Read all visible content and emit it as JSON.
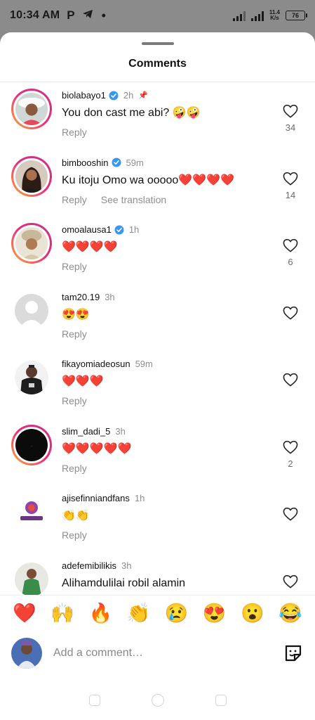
{
  "status_bar": {
    "time": "10:34 AM",
    "app_letter": "P",
    "net_top": "11.4",
    "net_bottom": "K/s",
    "battery": "76"
  },
  "sheet": {
    "title": "Comments"
  },
  "comments": [
    {
      "username": "biolabayo1",
      "verified": true,
      "time": "2h",
      "pinned": true,
      "text": "You don cast me abi? 🤪🤪",
      "reply_label": "Reply",
      "translate_label": "",
      "likes": "34",
      "avatar": "woman-in-white-hat-photo",
      "ring": true
    },
    {
      "username": "bimbooshin",
      "verified": true,
      "time": "59m",
      "pinned": false,
      "text": "Ku itoju Omo wa ooooo❤️❤️❤️❤️",
      "reply_label": "Reply",
      "translate_label": "See translation",
      "likes": "14",
      "avatar": "woman-long-hair-photo",
      "ring": true
    },
    {
      "username": "omoalausa1",
      "verified": true,
      "time": "1h",
      "pinned": false,
      "text": "❤️❤️❤️❤️",
      "reply_label": "Reply",
      "translate_label": "",
      "likes": "6",
      "avatar": "woman-gele-photo",
      "ring": true
    },
    {
      "username": "tam20.19",
      "verified": false,
      "time": "3h",
      "pinned": false,
      "text": "😍😍",
      "reply_label": "Reply",
      "translate_label": "",
      "likes": "",
      "avatar": "default-avatar",
      "ring": false
    },
    {
      "username": "fikayomiadeosun",
      "verified": false,
      "time": "59m",
      "pinned": false,
      "text": "❤️❤️❤️",
      "reply_label": "Reply",
      "translate_label": "",
      "likes": "",
      "avatar": "man-black-shirt-photo",
      "ring": false
    },
    {
      "username": "slim_dadi_5",
      "verified": false,
      "time": "3h",
      "pinned": false,
      "text": "❤️❤️❤️❤️❤️",
      "reply_label": "Reply",
      "translate_label": "",
      "likes": "2",
      "avatar": "dark-logo-avatar",
      "ring": true
    },
    {
      "username": "ajisefinniandfans",
      "verified": false,
      "time": "1h",
      "pinned": false,
      "text": "👏👏",
      "reply_label": "Reply",
      "translate_label": "",
      "likes": "",
      "avatar": "fanpage-logo",
      "ring": false
    },
    {
      "username": "adefemibilikis",
      "verified": false,
      "time": "3h",
      "pinned": false,
      "text": "Alihamdulilai robil alamin",
      "reply_label": "",
      "translate_label": "",
      "likes": "",
      "avatar": "woman-green-dress-photo",
      "ring": false
    }
  ],
  "emoji_bar": [
    "❤️",
    "🙌",
    "🔥",
    "👏",
    "😢",
    "😍",
    "😮",
    "😂"
  ],
  "composer": {
    "placeholder": "Add a comment…"
  },
  "colors": {
    "accent_blue": "#3897f0",
    "ring_start": "#f9b233",
    "ring_end": "#c13584",
    "muted": "#8e8e8e"
  }
}
